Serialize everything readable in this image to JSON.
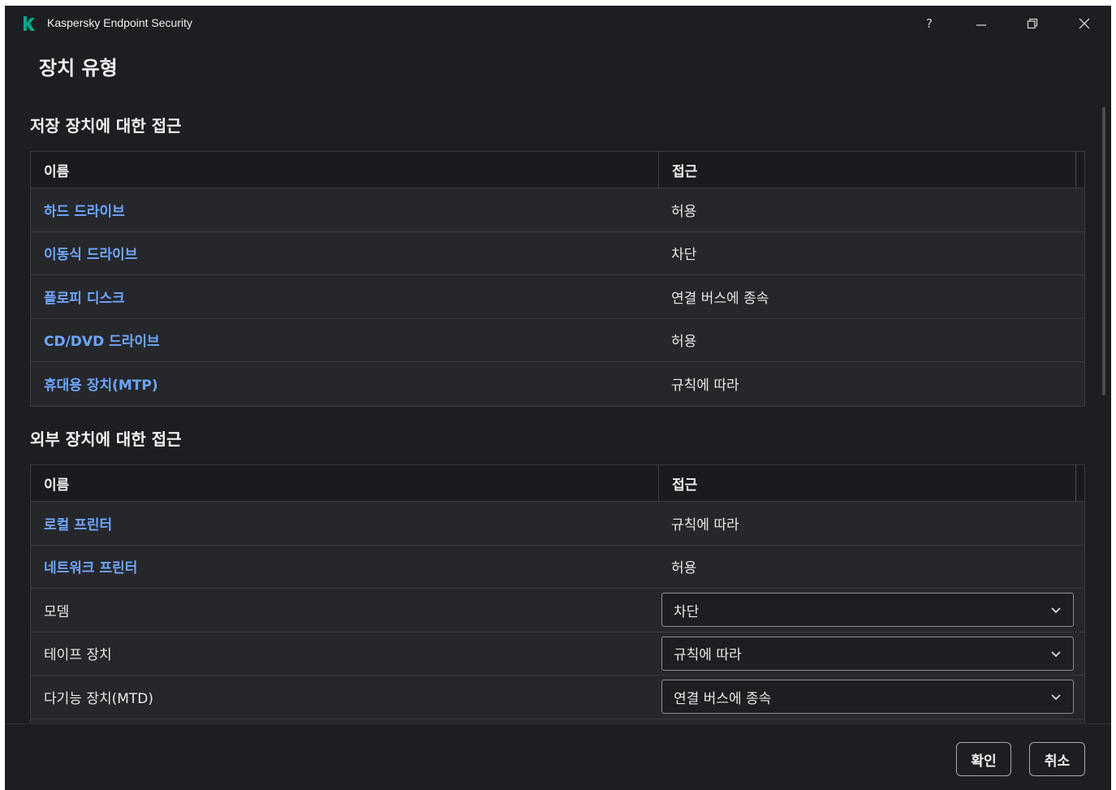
{
  "window": {
    "app_title": "Kaspersky Endpoint Security",
    "help_label": "?",
    "page_title": "장치 유형"
  },
  "storage": {
    "section_title": "저장 장치에 대한 접근",
    "col_name": "이름",
    "col_access": "접근",
    "rows": [
      {
        "name": "하드 드라이브",
        "access": "허용"
      },
      {
        "name": "이동식 드라이브",
        "access": "차단"
      },
      {
        "name": "플로피 디스크",
        "access": "연결 버스에 종속"
      },
      {
        "name": "CD/DVD 드라이브",
        "access": "허용"
      },
      {
        "name": "휴대용 장치(MTP)",
        "access": "규칙에 따라"
      }
    ]
  },
  "external": {
    "section_title": "외부 장치에 대한 접근",
    "col_name": "이름",
    "col_access": "접근",
    "link_rows": [
      {
        "name": "로컬 프린터",
        "access": "규칙에 따라"
      },
      {
        "name": "네트워크 프린터",
        "access": "허용"
      }
    ],
    "select_rows": [
      {
        "name": "모뎀",
        "access": "차단"
      },
      {
        "name": "테이프 장치",
        "access": "규칙에 따라"
      },
      {
        "name": "다기능 장치(MTD)",
        "access": "연결 버스에 종속"
      }
    ]
  },
  "footer": {
    "ok_label": "확인",
    "cancel_label": "취소"
  },
  "colors": {
    "background": "#1d1e21",
    "link": "#6ea6ff",
    "logo": "#00a88e"
  }
}
